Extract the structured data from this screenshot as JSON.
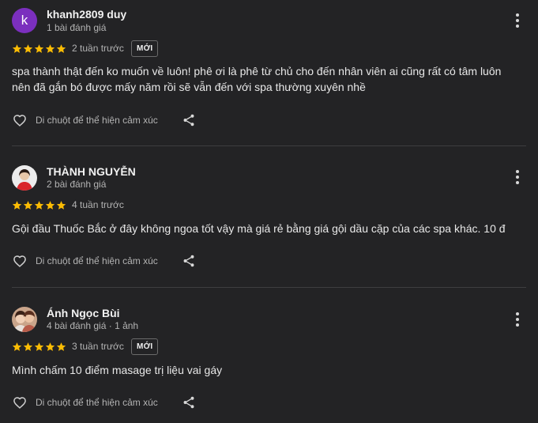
{
  "reviews": [
    {
      "avatar_letter": "k",
      "avatar_color": "#7b2fbe",
      "name": "khanh2809 duy",
      "meta": "1 bài đánh giá",
      "rating": 5,
      "time": "2 tuần trước",
      "badge": "MỚI",
      "text_lines": [
        "spa thành thật đến ko muốn về luôn! phê ơi là phê từ chủ cho đến nhân viên ai cũng rất có tâm luôn",
        "nên đã gắn bó được mấy năm rồi sẽ vẫn đến với spa thường xuyên nhề"
      ],
      "react_label": "Di chuột để thể hiện cảm xúc"
    },
    {
      "name": "THÀNH NGUYỄN",
      "meta": "2 bài đánh giá",
      "rating": 5,
      "time": "4 tuần trước",
      "text_lines": [
        "Gội đầu Thuốc Bắc ở đây không ngoa tốt vậy mà giá rẻ bằng giá gội dầu cặp của các spa khác. 10 đ"
      ],
      "react_label": "Di chuột để thể hiện cảm xúc"
    },
    {
      "name": "Ánh Ngọc Bùi",
      "meta": "4 bài đánh giá · 1 ảnh",
      "rating": 5,
      "time": "3 tuần trước",
      "badge": "MỚI",
      "text_lines": [
        "Mình chấm 10 điểm masage trị liệu vai gáy"
      ],
      "react_label": "Di chuột để thể hiện cảm xúc"
    }
  ],
  "colors": {
    "background": "#232325",
    "star": "#fbbc04",
    "divider": "#3e3e40"
  },
  "icons": [
    "more-vert-icon",
    "star-icon",
    "heart-outline-icon",
    "share-icon"
  ]
}
